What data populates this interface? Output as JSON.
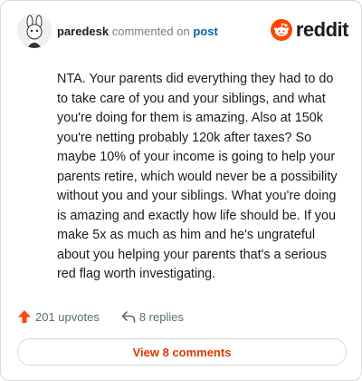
{
  "header": {
    "username": "paredesk",
    "action": "commented on",
    "link": "post",
    "brand": "reddit"
  },
  "comment": {
    "text": "NTA. Your parents did everything they had to do to take care of you and your siblings, and what you're doing for them is amazing. Also at 150k you're netting probably 120k after taxes? So maybe 10% of your income is going to help your parents retire, which would never be a possibility without you and your siblings. What you're doing is amazing and exactly how life should be. If you make 5x as much as him and he's ungrateful about you helping your parents that's a serious red flag worth investigating."
  },
  "actions": {
    "upvotes": "201 upvotes",
    "replies": "8 replies"
  },
  "view_button": "View 8 comments",
  "colors": {
    "brand": "#ff4500",
    "accent": "#d93a00",
    "link": "#0a60a8"
  }
}
